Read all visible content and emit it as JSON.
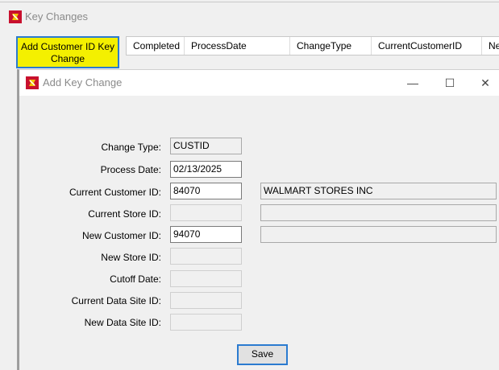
{
  "main_window": {
    "title": "Key Changes",
    "add_button_label": "Add Customer ID Key Change",
    "grid_columns": [
      "Completed",
      "ProcessDate",
      "ChangeType",
      "CurrentCustomerID",
      "Ne"
    ]
  },
  "dialog": {
    "title": "Add Key Change",
    "controls": {
      "minimize": "—",
      "maximize": "☐",
      "close": "✕"
    },
    "labels": {
      "change_type": "Change Type:",
      "process_date": "Process Date:",
      "current_customer_id": "Current Customer ID:",
      "current_store_id": "Current Store ID:",
      "new_customer_id": "New Customer ID:",
      "new_store_id": "New Store ID:",
      "cutoff_date": "Cutoff Date:",
      "current_data_site_id": "Current Data Site ID:",
      "new_data_site_id": "New Data Site ID:"
    },
    "values": {
      "change_type": "CUSTID",
      "process_date": "02/13/2025",
      "current_customer_id": "84070",
      "current_customer_name": "WALMART STORES INC",
      "current_store_id": "",
      "current_store_name": "",
      "new_customer_id": "94070",
      "new_customer_name": "",
      "new_store_id": "",
      "cutoff_date": "",
      "current_data_site_id": "",
      "new_data_site_id": ""
    },
    "save_label": "Save"
  },
  "colors": {
    "highlight": "#f4f000",
    "focus_border": "#2b7bd0"
  },
  "icons": {
    "app": "app-logo-icon"
  }
}
